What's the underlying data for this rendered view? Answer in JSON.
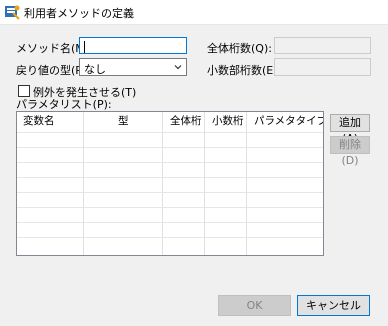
{
  "window": {
    "title": "利用者メソッドの定義"
  },
  "form": {
    "method_name_label": "メソッド名(M):",
    "method_name_value": "",
    "return_type_label": "戻り値の型(R):",
    "return_type_value": "なし",
    "total_digits_label": "全体桁数(Q):",
    "total_digits_value": "",
    "decimal_digits_label": "小数部桁数(E):",
    "decimal_digits_value": "",
    "raise_exception_label": "例外を発生させる(T)",
    "raise_exception_checked": false,
    "param_list_label": "パラメタリスト(P):"
  },
  "param_table": {
    "columns": [
      "変数名",
      "型",
      "全体桁",
      "小数桁",
      "パラメタタイプ"
    ],
    "rows": []
  },
  "buttons": {
    "add": "追加(A)",
    "delete": "削除(D)",
    "ok": "OK",
    "cancel": "キャンセル"
  }
}
